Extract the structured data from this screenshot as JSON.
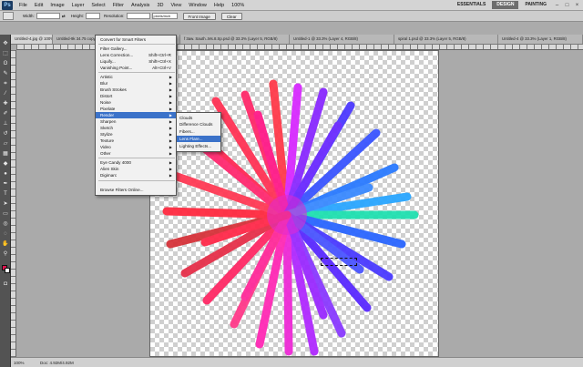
{
  "menubar": {
    "logo": "Ps",
    "items": [
      "File",
      "Edit",
      "Image",
      "Layer",
      "Select",
      "Filter",
      "Analysis",
      "3D",
      "View",
      "Window",
      "Help"
    ],
    "zoom": "100%",
    "workspaces": [
      "ESSENTIALS",
      "DESIGN",
      "PAINTING"
    ],
    "active_workspace": "DESIGN"
  },
  "options_bar": {
    "width_label": "Width:",
    "height_label": "Height:",
    "resolution_label": "Resolution:",
    "resolution_unit": "pixels/inch",
    "front_image_label": "Front Image",
    "clear_label": "Clear"
  },
  "tabs": [
    "Untitled-4.jpg @ 100% (RGB/8)",
    "Untitled-9k 34.75 copy.jpg @ 33.3% (RGB/8)",
    "...aves copy.psd @ 33...",
    "f 3aw. Sauth..Ms.8.Sp.psd @ 33.3% (Layer 5, RGB/8)",
    "Untitled-1 @ 33.3% (Layer 4, RGB/8)",
    "spiral 1.psd @ 33.3% (Layer 5, RGB/8)",
    "Untitled-4 @ 33.3% (Layer 1, RGB/8)"
  ],
  "filter_menu": {
    "items": [
      {
        "label": "Convert for Smart Filters"
      },
      {
        "label": "Filter Gallery..."
      },
      {
        "label": "Lens Correction...",
        "shortcut": "Shift+Ctrl+R"
      },
      {
        "label": "Liquify...",
        "shortcut": "Shift+Ctrl+X"
      },
      {
        "label": "Vanishing Point...",
        "shortcut": "Alt+Ctrl+V"
      },
      {
        "label": "Artistic",
        "submenu": true
      },
      {
        "label": "Blur",
        "submenu": true
      },
      {
        "label": "Brush Strokes",
        "submenu": true
      },
      {
        "label": "Distort",
        "submenu": true
      },
      {
        "label": "Noise",
        "submenu": true
      },
      {
        "label": "Pixelate",
        "submenu": true
      },
      {
        "label": "Render",
        "submenu": true,
        "highlighted": true
      },
      {
        "label": "Sharpen",
        "submenu": true
      },
      {
        "label": "Sketch",
        "submenu": true
      },
      {
        "label": "Stylize",
        "submenu": true
      },
      {
        "label": "Texture",
        "submenu": true
      },
      {
        "label": "Video",
        "submenu": true
      },
      {
        "label": "Other",
        "submenu": true
      },
      {
        "label": "Eye Candy 4000",
        "submenu": true
      },
      {
        "label": "Alien Skin",
        "submenu": true
      },
      {
        "label": "Digimarc",
        "submenu": true
      },
      {
        "label": "Browse Filters Online..."
      }
    ]
  },
  "render_submenu": {
    "items": [
      {
        "label": "Clouds"
      },
      {
        "label": "Difference Clouds"
      },
      {
        "label": "Fibers..."
      },
      {
        "label": "Lens Flare...",
        "highlighted": true
      },
      {
        "label": "Lighting Effects..."
      }
    ]
  },
  "status": {
    "zoom": "100%",
    "doc_size": "Doc: 4.92M/4.92M"
  },
  "colors": {
    "foreground": "#e0134f",
    "background": "#ffffff",
    "highlight": "#3b72c9"
  }
}
